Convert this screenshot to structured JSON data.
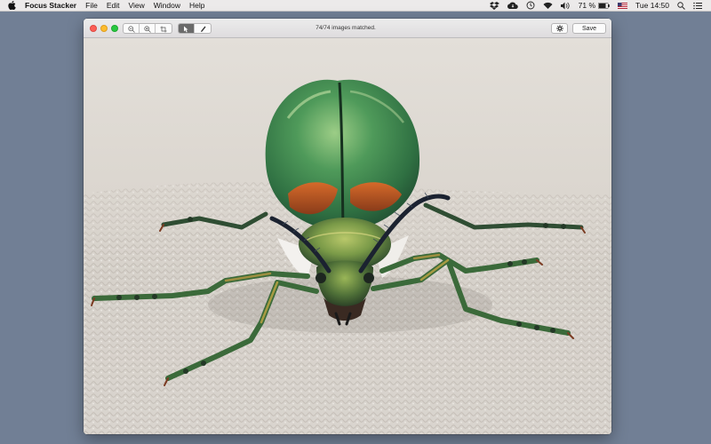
{
  "menubar": {
    "app_name": "Focus Stacker",
    "menus": [
      "File",
      "Edit",
      "View",
      "Window",
      "Help"
    ],
    "battery_percent": "71 %",
    "clock": "Tue 14:50",
    "status_icons": [
      "dropbox-icon",
      "cloud-icon",
      "time-machine-icon",
      "wifi-icon",
      "volume-icon",
      "battery-icon",
      "flag-icon",
      "search-icon",
      "list-icon"
    ]
  },
  "window": {
    "status": "74/74 images matched.",
    "save_label": "Save",
    "toolbar": {
      "zoom_tools": [
        "zoom-out-icon",
        "zoom-in-icon",
        "crop-icon"
      ],
      "edit_tools": [
        "pointer-icon",
        "brush-icon"
      ],
      "selected_tool": "pointer"
    }
  },
  "image": {
    "subject": "beetle",
    "colors": {
      "background": "#dedad4",
      "shell_green": "#3e8a4e",
      "shell_highlight": "#8bc07d",
      "copper": "#c05a22",
      "legs": "#2f4d33"
    }
  }
}
